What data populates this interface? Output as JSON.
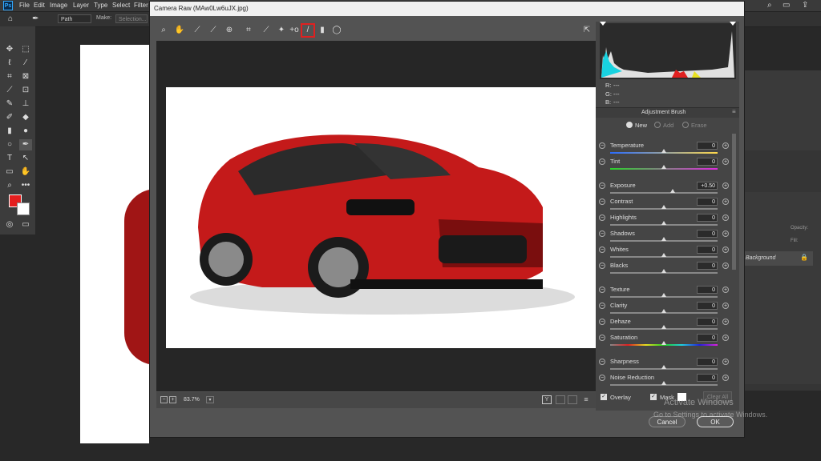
{
  "menubar": {
    "logo": "Ps",
    "items": [
      "File",
      "Edit",
      "Image",
      "Layer",
      "Type",
      "Select",
      "Filter"
    ]
  },
  "optbar": {
    "path_mode": "Path",
    "make_label": "Make:",
    "selection_label": "Selection..."
  },
  "dialog": {
    "title": "Camera Raw (MAw0Lw6uJX.jpg)",
    "rgb": {
      "r_label": "R:",
      "g_label": "G:",
      "b_label": "B:",
      "r": "---",
      "g": "---",
      "b": "---"
    },
    "panel_title": "Adjustment Brush",
    "modes": {
      "new": "New",
      "add": "Add",
      "erase": "Erase",
      "selected": "New"
    },
    "sliders": [
      {
        "label": "Temperature",
        "value": "0"
      },
      {
        "label": "Tint",
        "value": "0"
      },
      {
        "label": "Exposure",
        "value": "+0.50"
      },
      {
        "label": "Contrast",
        "value": "0"
      },
      {
        "label": "Highlights",
        "value": "0"
      },
      {
        "label": "Shadows",
        "value": "0"
      },
      {
        "label": "Whites",
        "value": "0"
      },
      {
        "label": "Blacks",
        "value": "0"
      },
      {
        "label": "Texture",
        "value": "0"
      },
      {
        "label": "Clarity",
        "value": "0"
      },
      {
        "label": "Dehaze",
        "value": "0"
      },
      {
        "label": "Saturation",
        "value": "0"
      },
      {
        "label": "Sharpness",
        "value": "0"
      },
      {
        "label": "Noise Reduction",
        "value": "0"
      }
    ],
    "zoom": "83.7%",
    "overlay_label": "Overlay",
    "mask_label": "Mask",
    "clear_all": "Clear All",
    "cancel": "Cancel",
    "ok": "OK",
    "y_button": "Y"
  },
  "right_panel": {
    "opacity_label": "Opacity:",
    "opacity_value": "100%",
    "fill_label": "Fill:",
    "fill_value": "100%",
    "layer_name": "Background"
  },
  "watermark": {
    "line1": "Activate Windows",
    "line2": "Go to Settings to activate Windows."
  },
  "colors": {
    "accent_red": "#d9201f",
    "highlight_red": "#e02020",
    "car_red": "#c41a1a"
  }
}
